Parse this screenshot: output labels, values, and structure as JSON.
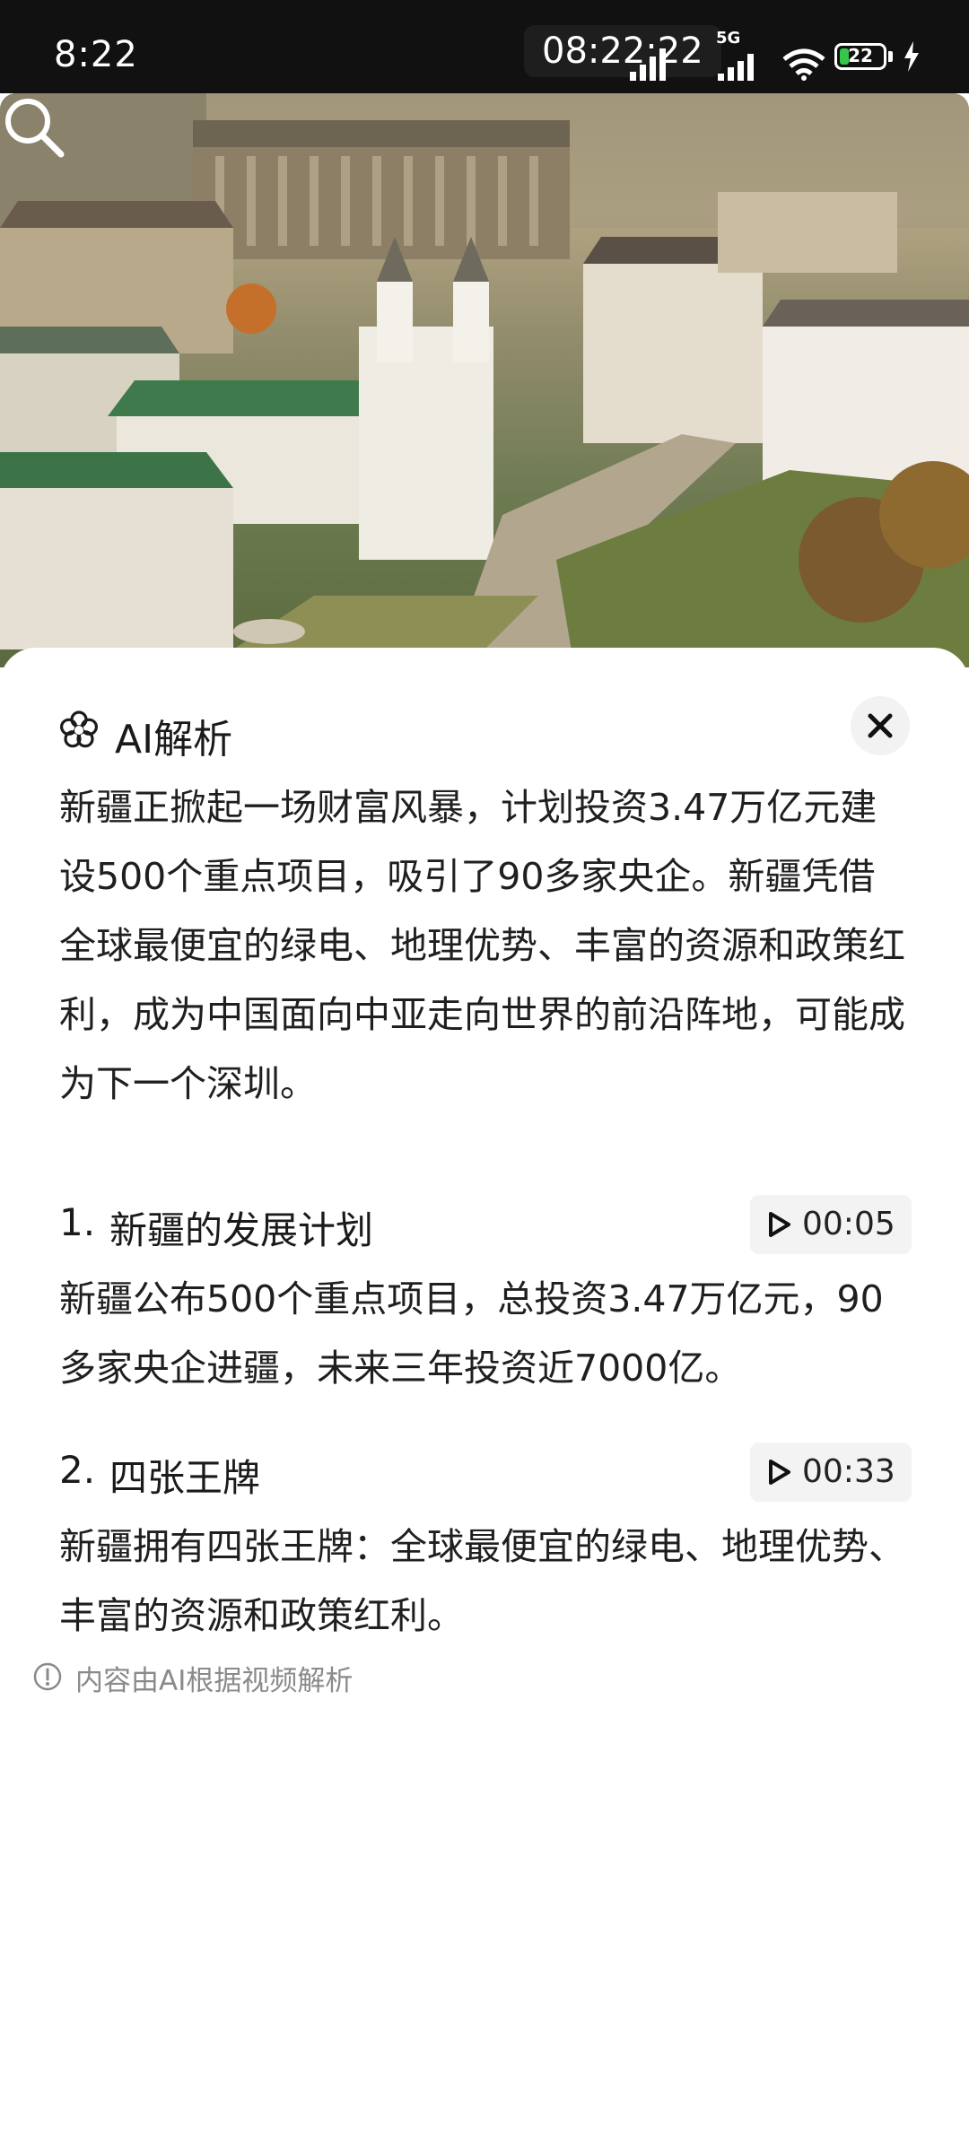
{
  "status_bar": {
    "time": "8:22",
    "center_clock": "08:22:22",
    "network_label": "5G",
    "battery_level": "22",
    "battery_fraction": 0.22
  },
  "hero": {
    "search_icon": "search-icon"
  },
  "panel": {
    "logo_icon": "ai-flower-icon",
    "title": "AI解析",
    "close_icon": "close-icon",
    "summary": "新疆正掀起一场财富风暴，计划投资3.47万亿元建设500个重点项目，吸引了90多家央企。新疆凭借全球最便宜的绿电、地理优势、丰富的资源和政策红利，成为中国面向中亚走向世界的前沿阵地，可能成为下一个深圳。",
    "sections": [
      {
        "number": "1.",
        "title": "新疆的发展计划",
        "timestamp": "00:05",
        "body": "新疆公布500个重点项目，总投资3.47万亿元，90多家央企进疆，未来三年投资近7000亿。"
      },
      {
        "number": "2.",
        "title": "四张王牌",
        "timestamp": "00:33",
        "body": "新疆拥有四张王牌：全球最便宜的绿电、地理优势、丰富的资源和政策红利。"
      }
    ],
    "footer_note": "内容由AI根据视频解析"
  },
  "colors": {
    "sheet_background": "#ffffff",
    "chip_background": "#f3f3f3",
    "note_text": "#8a8a8a",
    "status_bar": "#111111"
  }
}
